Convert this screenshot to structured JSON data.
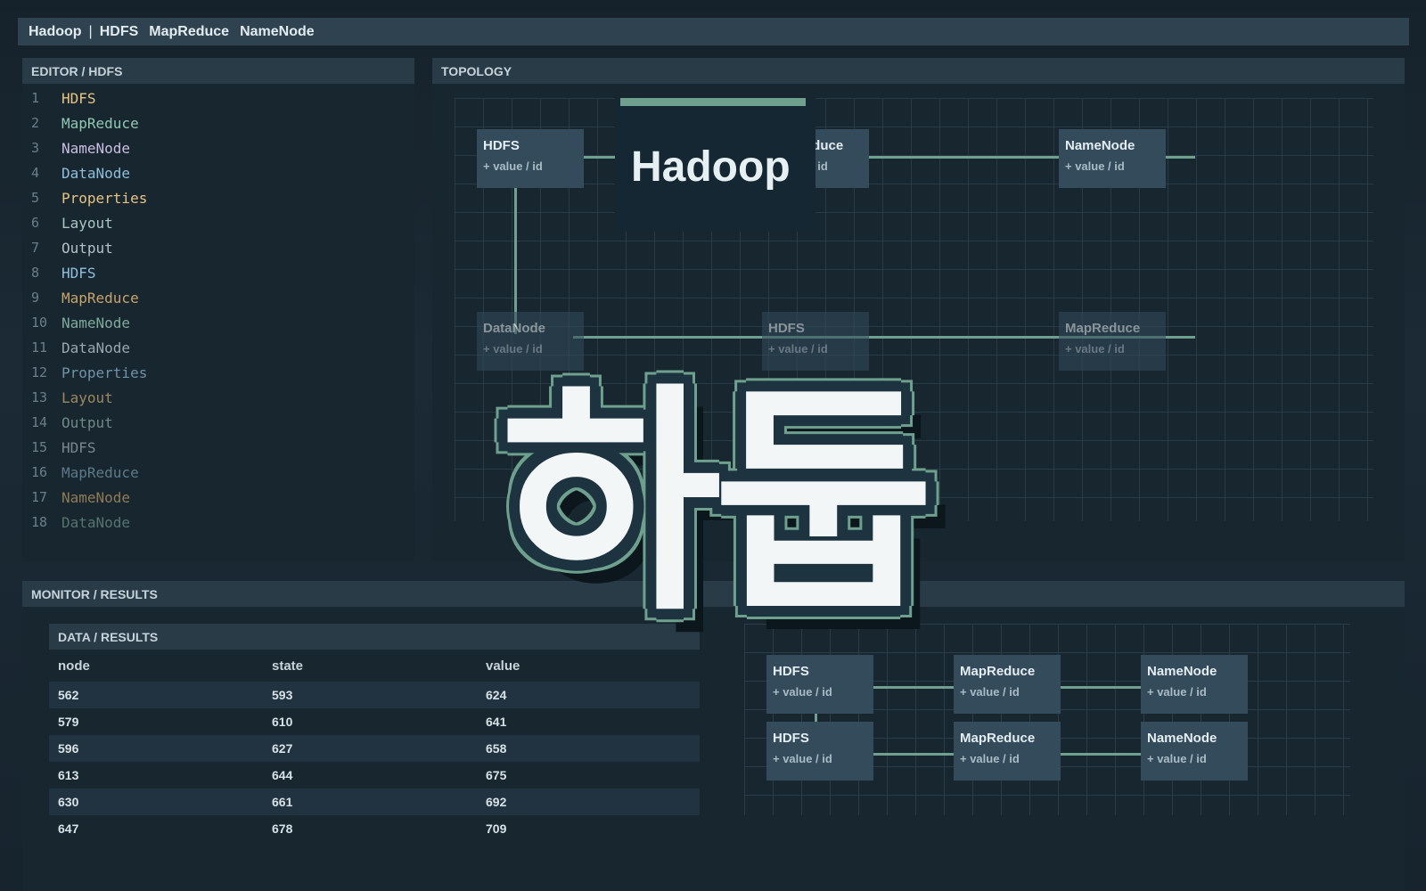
{
  "topbar": {
    "brand": "Hadoop",
    "separator": "|",
    "nav": [
      "HDFS",
      "MapReduce",
      "NameNode"
    ]
  },
  "editor": {
    "title": "EDITOR / HDFS",
    "lines": [
      {
        "n": "1",
        "text": "HDFS",
        "color": "#e6c483"
      },
      {
        "n": "2",
        "text": "MapReduce",
        "color": "#8fc9b2"
      },
      {
        "n": "3",
        "text": "NameNode",
        "color": "#c9bfe3"
      },
      {
        "n": "4",
        "text": "DataNode",
        "color": "#8fbfdc"
      },
      {
        "n": "5",
        "text": "Properties",
        "color": "#e6c483"
      },
      {
        "n": "6",
        "text": "Layout",
        "color": "#a9c7c3"
      },
      {
        "n": "7",
        "text": "Output",
        "color": "#b5c0c6"
      },
      {
        "n": "8",
        "text": "HDFS",
        "color": "#8fbfdc"
      },
      {
        "n": "9",
        "text": "MapReduce",
        "color": "#c7a46a"
      },
      {
        "n": "10",
        "text": "NameNode",
        "color": "#7fab9c"
      },
      {
        "n": "11",
        "text": "DataNode",
        "color": "#98a7b0"
      },
      {
        "n": "12",
        "text": "Properties",
        "color": "#6f93a8"
      },
      {
        "n": "13",
        "text": "Layout",
        "color": "#9c8860"
      },
      {
        "n": "14",
        "text": "Output",
        "color": "#6f8a86"
      },
      {
        "n": "15",
        "text": "HDFS",
        "color": "#7a8790"
      },
      {
        "n": "16",
        "text": "MapReduce",
        "color": "#5d7a8a"
      },
      {
        "n": "17",
        "text": "NameNode",
        "color": "#8f7b55"
      },
      {
        "n": "18",
        "text": "DataNode",
        "color": "#557470"
      }
    ]
  },
  "topology": {
    "title": "TOPOLOGY",
    "nodes": [
      {
        "name": "HDFS",
        "sub": "+ value / id"
      },
      {
        "name": "MapReduce",
        "sub": "+ value / id"
      },
      {
        "name": "NameNode",
        "sub": "+ value / id"
      },
      {
        "name": "DataNode",
        "sub": "+ value / id"
      },
      {
        "name": "HDFS",
        "sub": "+ value / id"
      },
      {
        "name": "MapReduce",
        "sub": "+ value / id"
      }
    ]
  },
  "overlay": {
    "title": "Hadoop",
    "korean": "하둡"
  },
  "monitor": {
    "title": "MONITOR / RESULTS"
  },
  "results": {
    "title": "DATA / RESULTS",
    "columns": [
      "node",
      "state",
      "value"
    ],
    "rows": [
      [
        "562",
        "593",
        "624"
      ],
      [
        "579",
        "610",
        "641"
      ],
      [
        "596",
        "627",
        "658"
      ],
      [
        "613",
        "644",
        "675"
      ],
      [
        "630",
        "661",
        "692"
      ],
      [
        "647",
        "678",
        "709"
      ]
    ]
  },
  "mini_topology": {
    "nodes": [
      {
        "name": "HDFS",
        "sub": "+ value / id"
      },
      {
        "name": "MapReduce",
        "sub": "+ value / id"
      },
      {
        "name": "NameNode",
        "sub": "+ value / id"
      },
      {
        "name": "HDFS",
        "sub": "+ value / id"
      },
      {
        "name": "MapReduce",
        "sub": "+ value / id"
      },
      {
        "name": "NameNode",
        "sub": "+ value / id"
      }
    ]
  }
}
